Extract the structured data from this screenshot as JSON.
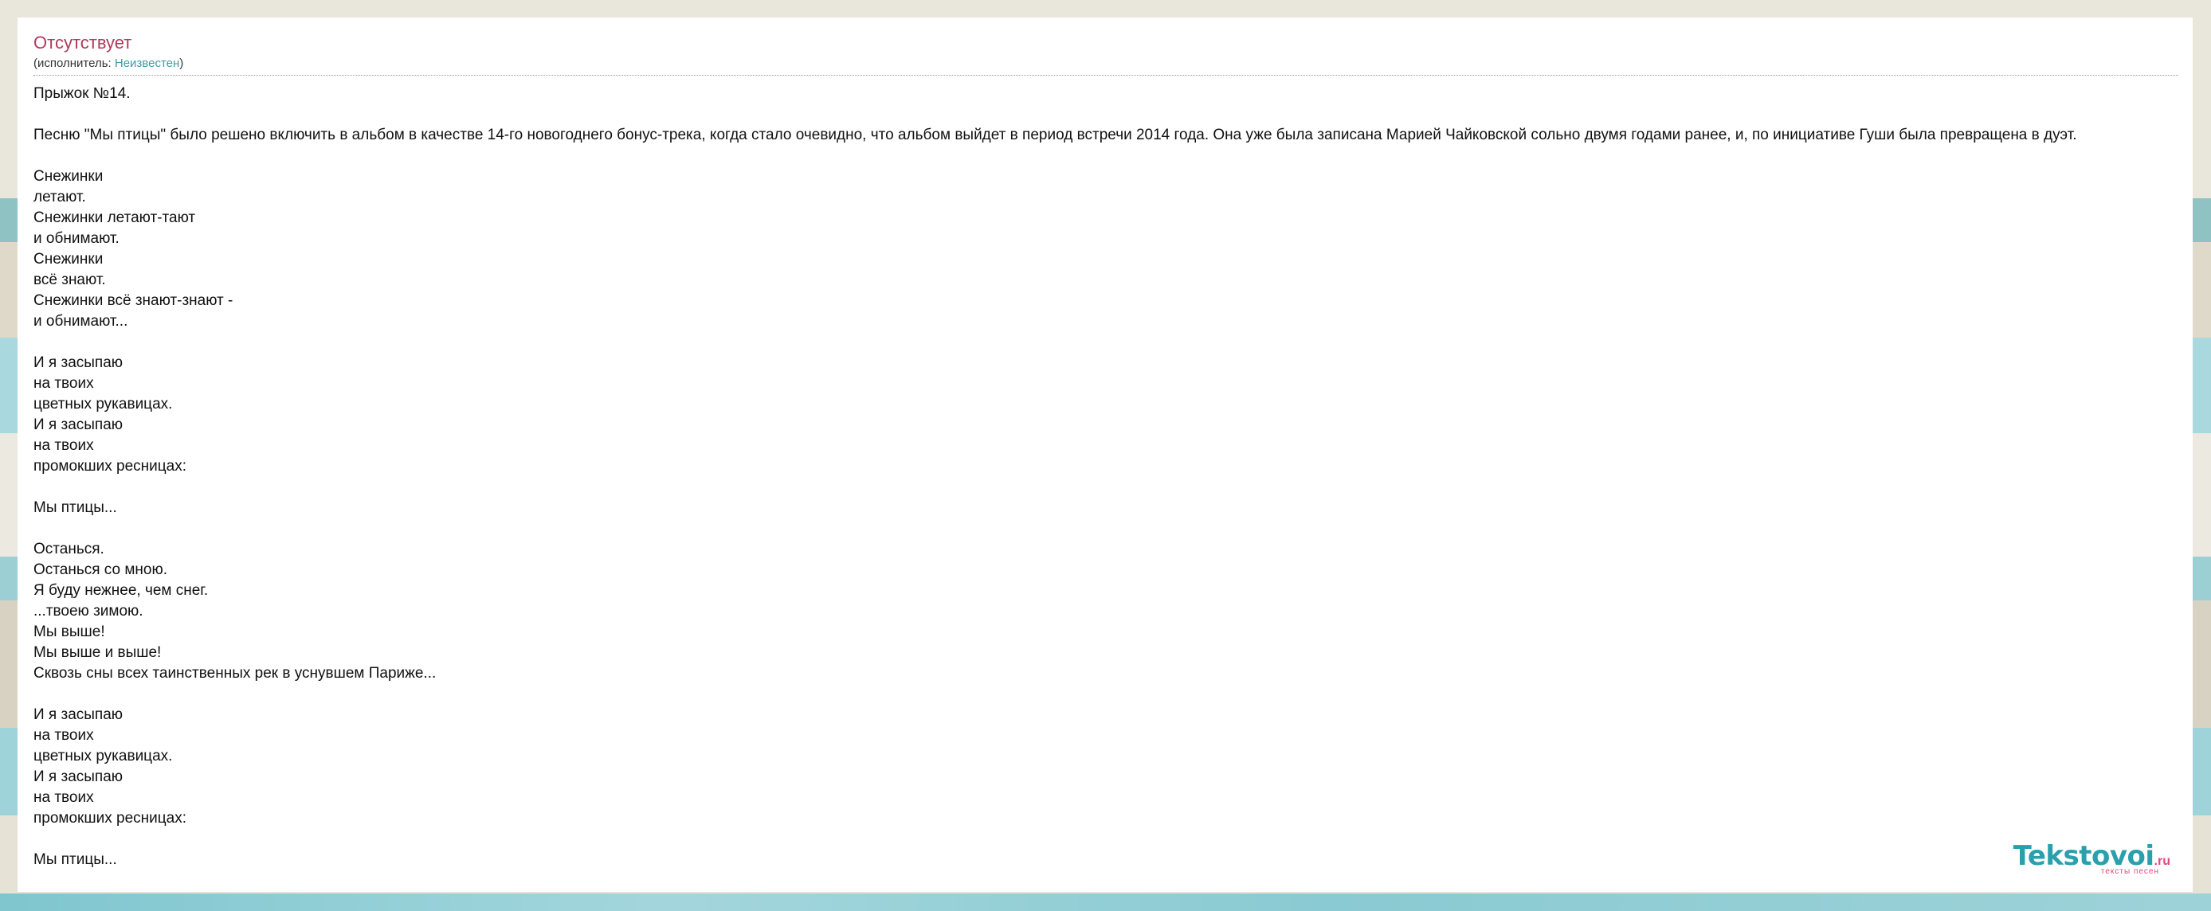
{
  "song": {
    "title": "Отсутствует",
    "artist_prefix": "(исполнитель: ",
    "artist_name": "Неизвестен",
    "artist_suffix": ")"
  },
  "lyrics": "Прыжок №14.\n\nПесню \"Мы птицы\" было решено включить в альбом в качестве 14-го новогоднего бонус-трека, когда стало очевидно, что альбом выйдет в период встречи 2014 года. Она уже была записана Марией Чайковской сольно двумя годами ранее, и, по инициативе Гуши была превращена в дуэт.\n\nСнежинки\nлетают.\nСнежинки летают-тают\nи обнимают.\nСнежинки\nвсё знают.\nСнежинки всё знают-знают -\nи обнимают...\n\nИ я засыпаю\nна твоих\nцветных рукавицах.\nИ я засыпаю\nна твоих\nпромокших ресницах:\n\nМы птицы...\n\nОстанься.\nОстанься со мною.\nЯ буду нежнее, чем снег.\n...твоею зимою.\nМы выше!\nМы выше и выше!\nСквозь сны всех таинственных рек в уснувшем Париже...\n\nИ я засыпаю\nна твоих\nцветных рукавицах.\nИ я засыпаю\nна твоих\nпромокших ресницах:\n\nМы птицы...",
  "logo": {
    "main": "Tekstovoi",
    "domain": ".ru",
    "tagline": "тексты песен"
  },
  "colors": {
    "title": "#b23a5c",
    "link": "#3f9aa7",
    "logo_main": "#2aa0ad",
    "logo_accent": "#e0497c"
  }
}
